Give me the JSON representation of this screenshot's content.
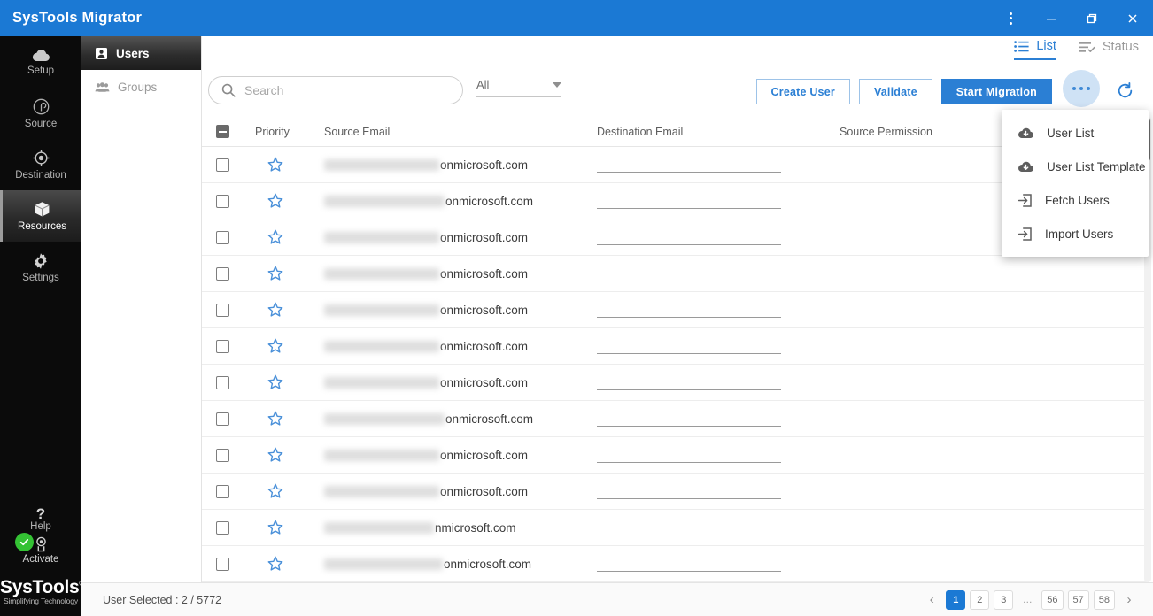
{
  "window": {
    "title": "SysTools Migrator",
    "controls": [
      {
        "name": "app-menu-button",
        "icon": "vertical-dots-icon"
      },
      {
        "name": "minimize-button",
        "icon": "minimize-icon"
      },
      {
        "name": "restore-button",
        "icon": "restore-icon"
      },
      {
        "name": "close-button",
        "icon": "close-icon"
      }
    ]
  },
  "rail": {
    "items": [
      {
        "label": "Setup",
        "icon": "cloud-icon",
        "active": false
      },
      {
        "label": "Source",
        "icon": "source-icon",
        "active": false
      },
      {
        "label": "Destination",
        "icon": "destination-icon",
        "active": false
      },
      {
        "label": "Resources",
        "icon": "box-icon",
        "active": true
      },
      {
        "label": "Settings",
        "icon": "gear-icon",
        "active": false
      }
    ],
    "help_label": "Help",
    "activate_label": "Activate",
    "brand_name": "SysTools",
    "brand_trademark": "®",
    "brand_tagline": "Simplifying Technology"
  },
  "entity_panel": {
    "items": [
      {
        "label": "Users",
        "icon": "user-badge-icon",
        "active": true
      },
      {
        "label": "Groups",
        "icon": "groups-icon",
        "active": false
      }
    ]
  },
  "view_tabs": [
    {
      "label": "List",
      "icon": "list-icon",
      "active": true
    },
    {
      "label": "Status",
      "icon": "checklist-icon",
      "active": false
    }
  ],
  "toolbar": {
    "search": {
      "value": "",
      "placeholder": "Search",
      "icon": "search-icon"
    },
    "filter": {
      "selected": "All",
      "icon": "chevron-down-icon"
    },
    "buttons": [
      {
        "label": "Create User",
        "style": "outline"
      },
      {
        "label": "Validate",
        "style": "outline"
      },
      {
        "label": "Start Migration",
        "style": "primary"
      }
    ],
    "more_button": {
      "icon": "horizontal-dots-icon",
      "active": true
    },
    "refresh_button": {
      "icon": "refresh-icon"
    }
  },
  "more_menu": {
    "items": [
      {
        "label": "User List",
        "icon": "cloud-download-icon"
      },
      {
        "label": "User List Template",
        "icon": "cloud-download-icon"
      },
      {
        "label": "Fetch Users",
        "icon": "import-box-icon"
      },
      {
        "label": "Import Users",
        "icon": "import-box-icon"
      }
    ]
  },
  "table": {
    "select_all_state": "indeterminate",
    "headers": [
      "Priority",
      "Source Email",
      "Destination Email",
      "Source Permission"
    ],
    "rows": [
      {
        "checked": false,
        "starred": false,
        "source_email_suffix": "onmicrosoft.com",
        "redact_width": 130,
        "destination_email": "",
        "source_permission": ""
      },
      {
        "checked": false,
        "starred": false,
        "source_email_suffix": "onmicrosoft.com",
        "redact_width": 136,
        "destination_email": "",
        "source_permission": ""
      },
      {
        "checked": false,
        "starred": false,
        "source_email_suffix": "onmicrosoft.com",
        "redact_width": 130,
        "destination_email": "",
        "source_permission": ""
      },
      {
        "checked": false,
        "starred": false,
        "source_email_suffix": "onmicrosoft.com",
        "redact_width": 130,
        "destination_email": "",
        "source_permission": ""
      },
      {
        "checked": false,
        "starred": false,
        "source_email_suffix": "onmicrosoft.com",
        "redact_width": 130,
        "destination_email": "",
        "source_permission": ""
      },
      {
        "checked": false,
        "starred": false,
        "source_email_suffix": "onmicrosoft.com",
        "redact_width": 130,
        "destination_email": "",
        "source_permission": ""
      },
      {
        "checked": false,
        "starred": false,
        "source_email_suffix": "onmicrosoft.com",
        "redact_width": 130,
        "destination_email": "",
        "source_permission": ""
      },
      {
        "checked": false,
        "starred": false,
        "source_email_suffix": "onmicrosoft.com",
        "redact_width": 136,
        "destination_email": "",
        "source_permission": ""
      },
      {
        "checked": false,
        "starred": false,
        "source_email_suffix": "onmicrosoft.com",
        "redact_width": 130,
        "destination_email": "",
        "source_permission": ""
      },
      {
        "checked": false,
        "starred": false,
        "source_email_suffix": "onmicrosoft.com",
        "redact_width": 130,
        "destination_email": "",
        "source_permission": ""
      },
      {
        "checked": false,
        "starred": false,
        "source_email_suffix": "nmicrosoft.com",
        "redact_width": 124,
        "destination_email": "",
        "source_permission": ""
      },
      {
        "checked": false,
        "starred": false,
        "source_email_suffix": "onmicrosoft.com",
        "redact_width": 134,
        "destination_email": "",
        "source_permission": ""
      }
    ]
  },
  "statusbar": {
    "selection_text": "User Selected : 2 / 5772",
    "pagination": {
      "prev_icon": "chevron-left-icon",
      "next_icon": "chevron-right-icon",
      "pages": [
        "1",
        "2",
        "3",
        "…",
        "56",
        "57",
        "58"
      ],
      "current": "1"
    }
  },
  "colors": {
    "brand_blue": "#1b79d4",
    "accent_blue": "#2b7fd4",
    "rail_black": "#0b0b0b",
    "activate_green": "#34c234",
    "star_blue": "#4a90d9"
  }
}
